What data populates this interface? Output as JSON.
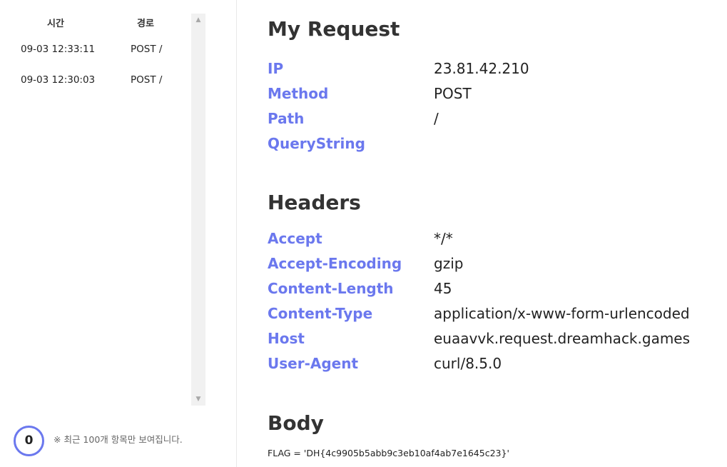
{
  "sidebar": {
    "headers": {
      "time": "시간",
      "path": "경로"
    },
    "requests": [
      {
        "time": "09-03 12:33:11",
        "path": "POST /"
      },
      {
        "time": "09-03 12:30:03",
        "path": "POST /"
      }
    ],
    "counter": "0",
    "note": "※ 최근 100개 항목만 보여집니다."
  },
  "request": {
    "title": "My Request",
    "ip_label": "IP",
    "ip": "23.81.42.210",
    "method_label": "Method",
    "method": "POST",
    "path_label": "Path",
    "path": "/",
    "query_label": "QueryString",
    "query": ""
  },
  "headers": {
    "title": "Headers",
    "items": [
      {
        "key": "Accept",
        "value": "*/*"
      },
      {
        "key": "Accept-Encoding",
        "value": "gzip"
      },
      {
        "key": "Content-Length",
        "value": "45"
      },
      {
        "key": "Content-Type",
        "value": "application/x-www-form-urlencoded"
      },
      {
        "key": "Host",
        "value": "euaavvk.request.dreamhack.games"
      },
      {
        "key": "User-Agent",
        "value": "curl/8.5.0"
      }
    ]
  },
  "body": {
    "title": "Body",
    "content": "FLAG = 'DH{4c9905b5abb9c3eb10af4ab7e1645c23}'"
  },
  "colors": {
    "accent": "#6b78ee",
    "text": "#222222",
    "heading": "#333333"
  }
}
